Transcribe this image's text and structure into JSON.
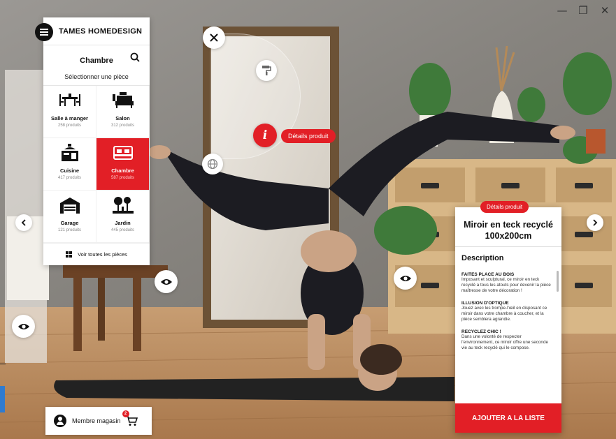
{
  "window": {
    "minimize_glyph": "—",
    "restore_glyph": "❐",
    "close_glyph": "✕"
  },
  "brand": "TAMES HOMEDESIGN",
  "room_panel": {
    "current_room": "Chambre",
    "subtitle": "Sélectionner une pièce",
    "rooms": [
      {
        "label": "Salle à manger",
        "count": "258 produits",
        "icon": "dining-table-icon",
        "active": false
      },
      {
        "label": "Salon",
        "count": "312 produits",
        "icon": "sofa-icon",
        "active": false
      },
      {
        "label": "Cuisine",
        "count": "417 produits",
        "icon": "kitchen-icon",
        "active": false
      },
      {
        "label": "Chambre",
        "count": "587 produits",
        "icon": "bed-icon",
        "active": true
      },
      {
        "label": "Garage",
        "count": "121 produits",
        "icon": "garage-icon",
        "active": false
      },
      {
        "label": "Jardin",
        "count": "445 produits",
        "icon": "garden-icon",
        "active": false
      }
    ],
    "see_all": "Voir toutes les pièces"
  },
  "hotspot": {
    "label": "Détails produit"
  },
  "product": {
    "tag": "Détails produit",
    "title": "Miroir en teck recyclé 100x200cm",
    "description_heading": "Description",
    "blocks": [
      {
        "heading": "FAITES PLACE AU BOIS",
        "text": "Imposant et sculptural, ce miroir en teck recyclé a tous les atouts pour devenir la pièce maîtresse de votre décoration !"
      },
      {
        "heading": "ILLUSION D'OPTIQUE",
        "text": "Jouez avec les trompe-l'œil en disposant ce miroir dans votre chambre à coucher, et la pièce semblera agrandie."
      },
      {
        "heading": "RECYCLEZ CHIC !",
        "text": "Dans une volonté de respecter l'environnement, ce miroir offre une seconde vie au teck recyclé qui le compose."
      }
    ],
    "cta": "AJOUTER A LA LISTE"
  },
  "member": {
    "label": "Membre magasin",
    "cart_count": "2"
  },
  "colors": {
    "accent": "#e21f26",
    "panel": "#ffffff",
    "text": "#111111"
  }
}
